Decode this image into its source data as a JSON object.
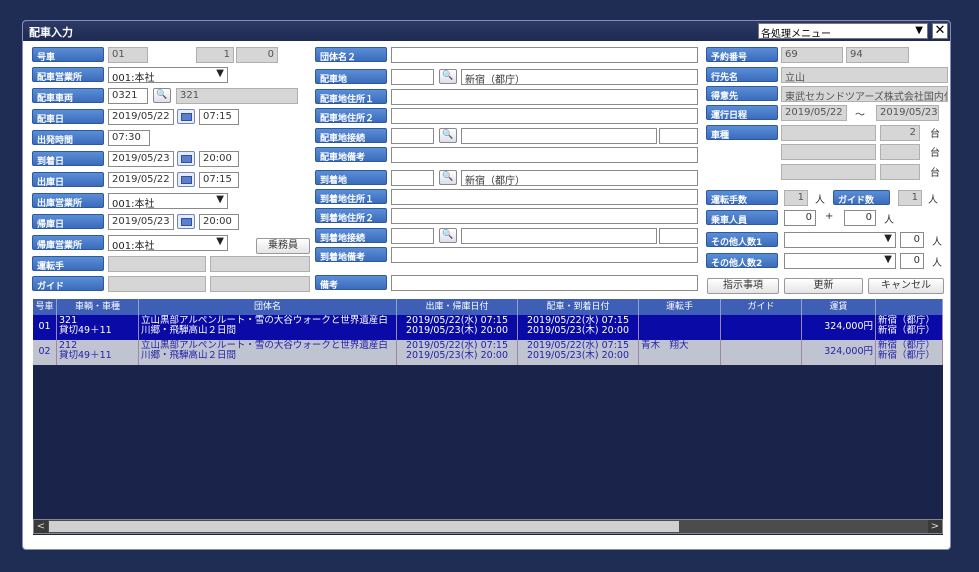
{
  "title": "配車入力",
  "menu_select": "各処理メニュー",
  "close_label": "✕",
  "left": {
    "gosha": {
      "label": "号車",
      "value": "01",
      "v2": "1",
      "v3": "0"
    },
    "haisha_eigyo": {
      "label": "配車営業所",
      "value": "001:本社"
    },
    "haisha_sharyo": {
      "label": "配車車両",
      "value": "0321",
      "name": "321"
    },
    "haisha_bi": {
      "label": "配車日",
      "date": "2019/05/22",
      "time": "07:15"
    },
    "shuppatsu": {
      "label": "出発時間",
      "time": "07:30"
    },
    "tochaku_bi": {
      "label": "到着日",
      "date": "2019/05/23",
      "time": "20:00"
    },
    "shukko_bi": {
      "label": "出庫日",
      "date": "2019/05/22",
      "time": "07:15"
    },
    "shukko_eigyo": {
      "label": "出庫営業所",
      "value": "001:本社"
    },
    "kiko_bi": {
      "label": "帰庫日",
      "date": "2019/05/23",
      "time": "20:00"
    },
    "kiko_eigyo": {
      "label": "帰庫営業所",
      "value": "001:本社"
    },
    "jomuin_btn": "乗務員",
    "untenshu": {
      "label": "運転手"
    },
    "guide": {
      "label": "ガイド"
    }
  },
  "middle": {
    "dantai2": {
      "label": "団体名２"
    },
    "haishachi": {
      "label": "配車地",
      "value": "新宿（都庁）"
    },
    "jusho1": {
      "label": "配車地住所１"
    },
    "jusho2": {
      "label": "配車地住所２"
    },
    "setsuzoku": {
      "label": "配車地接続"
    },
    "biko_h": {
      "label": "配車地備考"
    },
    "tochakuchi": {
      "label": "到着地",
      "value": "新宿（都庁）"
    },
    "t_jusho1": {
      "label": "到着地住所１"
    },
    "t_jusho2": {
      "label": "到着地住所２"
    },
    "t_setsuzoku": {
      "label": "到着地接続"
    },
    "t_biko": {
      "label": "到着地備考"
    },
    "biko": {
      "label": "備考"
    }
  },
  "right": {
    "yoyaku": {
      "label": "予約番号",
      "v1": "69",
      "v2": "94"
    },
    "ikisaki": {
      "label": "行先名",
      "value": "立山"
    },
    "tokuisaki": {
      "label": "得意先",
      "value": "東武セカンドツアーズ株式会社国内仕"
    },
    "unko": {
      "label": "運行日程",
      "from": "2019/05/22",
      "sep": "～",
      "to": "2019/05/23"
    },
    "shashu": {
      "label": "車種",
      "count": "2",
      "unit1": "台",
      "unit2": "台",
      "unit3": "台"
    },
    "untenshu_su": {
      "label": "運転手数",
      "value": "1",
      "unit": "人"
    },
    "guide_su": {
      "label": "ガイド数",
      "value": "1",
      "unit": "人"
    },
    "jousha": {
      "label": "乗車人員",
      "value": "0",
      "plus": "+",
      "value2": "0",
      "unit": "人"
    },
    "sonota1": {
      "label": "その他人数1",
      "value": "0",
      "unit": "人"
    },
    "sonota2": {
      "label": "その他人数2",
      "value": "0",
      "unit": "人"
    },
    "btn_shiji": "指示事項",
    "btn_koshin": "更新",
    "btn_cancel": "キャンセル"
  },
  "grid": {
    "headers": [
      "号車",
      "車輌・車種",
      "団体名",
      "出庫・帰庫日付",
      "配車・到着日付",
      "運転手",
      "ガイド",
      "運賃",
      ""
    ],
    "rows": [
      {
        "no": "01",
        "car1": "321",
        "car2": "貸切49＋11",
        "grp1": "立山黒部アルペンルート・雪の大谷ウォークと世界遺産白",
        "grp2": "川郷・飛騨高山２日間",
        "dep1": "2019/05/22(水) 07:15",
        "dep2": "2019/05/23(木) 20:00",
        "arr1": "2019/05/22(水) 07:15",
        "arr2": "2019/05/23(木) 20:00",
        "drv": "",
        "gd": "",
        "fee": "324,000円",
        "loc1": "新宿（都庁）",
        "loc2": "新宿（都庁）"
      },
      {
        "no": "02",
        "car1": "212",
        "car2": "貸切49＋11",
        "grp1": "立山黒部アルペンルート・雪の大谷ウォークと世界遺産白",
        "grp2": "川郷・飛騨高山２日間",
        "dep1": "2019/05/22(水) 07:15",
        "dep2": "2019/05/23(木) 20:00",
        "arr1": "2019/05/22(水) 07:15",
        "arr2": "2019/05/23(木) 20:00",
        "drv": "青木　翔大",
        "gd": "",
        "fee": "324,000円",
        "loc1": "新宿（都庁）",
        "loc2": "新宿（都庁）"
      }
    ]
  }
}
